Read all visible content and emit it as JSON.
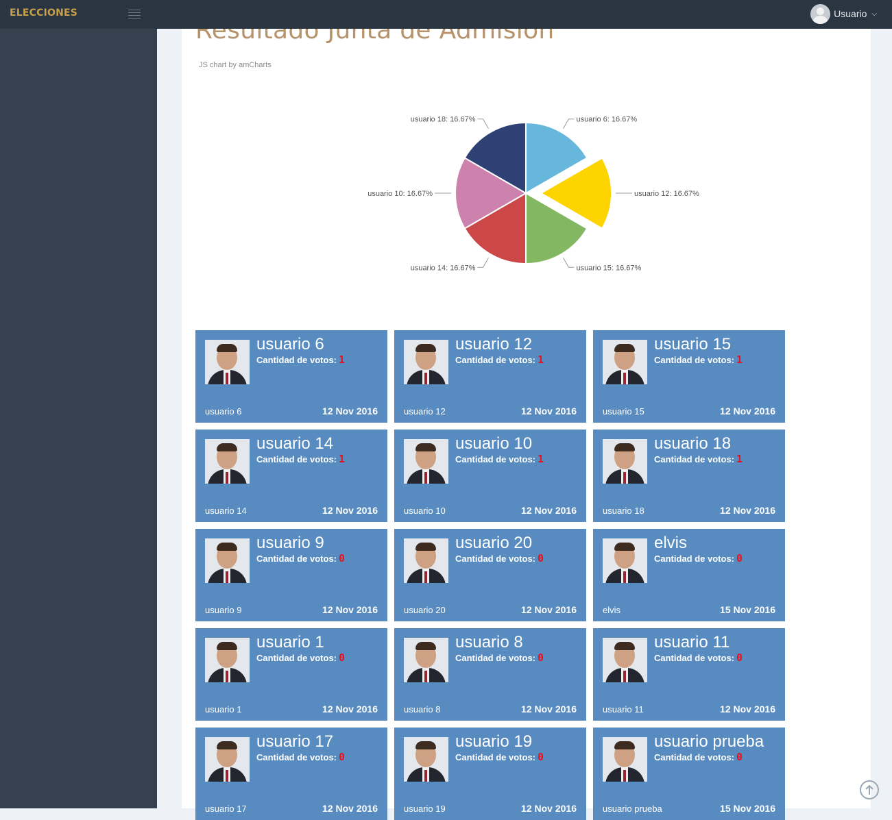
{
  "app": {
    "brand": "ELECCIONES"
  },
  "header": {
    "user_label": "Usuario"
  },
  "page": {
    "title": "Resultado Junta de Admision",
    "credit": "JS chart by amCharts"
  },
  "chart_data": {
    "type": "pie",
    "title": "",
    "slices": [
      {
        "label": "usuario 6",
        "value": 16.67,
        "color": "#67b7dc",
        "pulled": false
      },
      {
        "label": "usuario 12",
        "value": 16.67,
        "color": "#fdd400",
        "pulled": true
      },
      {
        "label": "usuario 15",
        "value": 16.67,
        "color": "#84b761",
        "pulled": false
      },
      {
        "label": "usuario 14",
        "value": 16.67,
        "color": "#cc4748",
        "pulled": false
      },
      {
        "label": "usuario 10",
        "value": 16.67,
        "color": "#cd82ad",
        "pulled": false
      },
      {
        "label": "usuario 18",
        "value": 16.67,
        "color": "#2f4074",
        "pulled": false
      }
    ]
  },
  "votes_label": "Cantidad de votos:",
  "colors": {
    "tile_bg": "#588cc0",
    "vote_count": "#e8121e",
    "title": "#b6936a"
  },
  "candidates": [
    {
      "name": "usuario 6",
      "votes": "1",
      "footer": "usuario 6",
      "date": "12 Nov 2016"
    },
    {
      "name": "usuario 12",
      "votes": "1",
      "footer": "usuario 12",
      "date": "12 Nov 2016"
    },
    {
      "name": "usuario 15",
      "votes": "1",
      "footer": "usuario 15",
      "date": "12 Nov 2016"
    },
    {
      "name": "usuario 14",
      "votes": "1",
      "footer": "usuario 14",
      "date": "12 Nov 2016"
    },
    {
      "name": "usuario 10",
      "votes": "1",
      "footer": "usuario 10",
      "date": "12 Nov 2016"
    },
    {
      "name": "usuario 18",
      "votes": "1",
      "footer": "usuario 18",
      "date": "12 Nov 2016"
    },
    {
      "name": "usuario 9",
      "votes": "0",
      "footer": "usuario 9",
      "date": "12 Nov 2016"
    },
    {
      "name": "usuario 20",
      "votes": "0",
      "footer": "usuario 20",
      "date": "12 Nov 2016"
    },
    {
      "name": "elvis",
      "votes": "0",
      "footer": "elvis",
      "date": "15 Nov 2016"
    },
    {
      "name": "usuario 1",
      "votes": "0",
      "footer": "usuario 1",
      "date": "12 Nov 2016"
    },
    {
      "name": "usuario 8",
      "votes": "0",
      "footer": "usuario 8",
      "date": "12 Nov 2016"
    },
    {
      "name": "usuario 11",
      "votes": "0",
      "footer": "usuario 11",
      "date": "12 Nov 2016"
    },
    {
      "name": "usuario 17",
      "votes": "0",
      "footer": "usuario 17",
      "date": "12 Nov 2016"
    },
    {
      "name": "usuario 19",
      "votes": "0",
      "footer": "usuario 19",
      "date": "12 Nov 2016"
    },
    {
      "name": "usuario prueba",
      "votes": "0",
      "footer": "usuario prueba",
      "date": "15 Nov 2016"
    }
  ]
}
